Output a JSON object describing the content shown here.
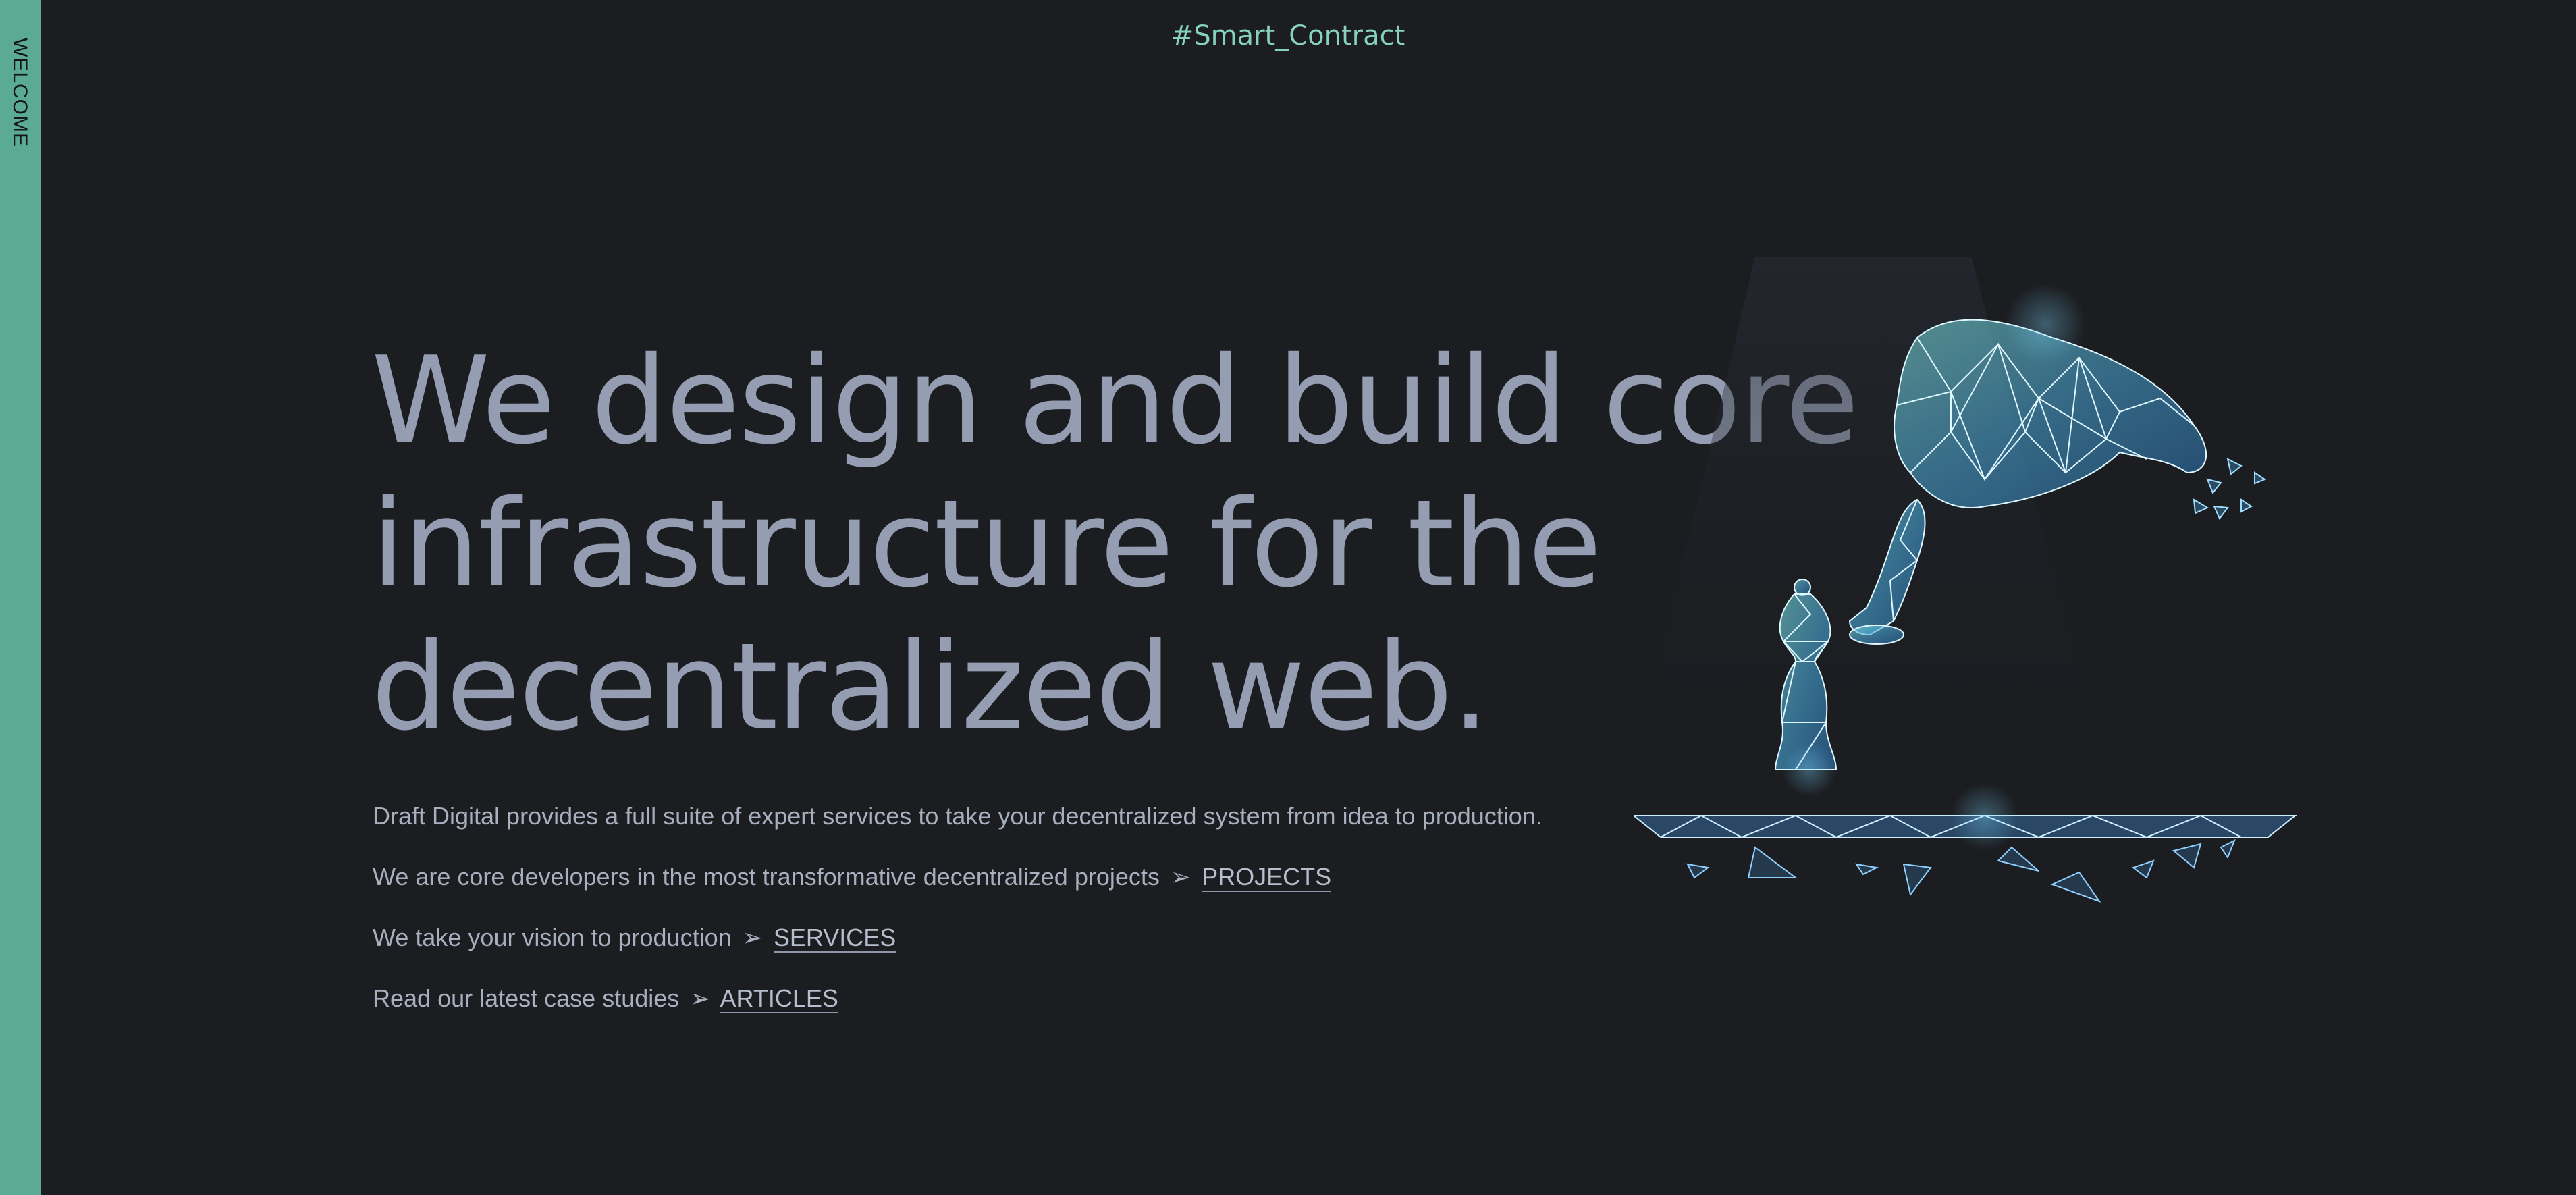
{
  "sidebar": {
    "label": "WELCOME"
  },
  "header": {
    "tag": "#Smart_Contract"
  },
  "hero": {
    "headline_lines": [
      "We design and build core",
      "infrastructure for the",
      "decentralized web."
    ],
    "intro": "Draft Digital provides a full suite of expert services to take your decentralized system from idea to production.",
    "lines": [
      {
        "text": "We are core developers in the most transformative decentralized projects",
        "arrow": "➢",
        "link": "PROJECTS"
      },
      {
        "text": "We take your vision to production",
        "arrow": "➢",
        "link": "SERVICES"
      },
      {
        "text": "Read our latest case studies",
        "arrow": "➢",
        "link": "ARTICLES"
      }
    ]
  },
  "colors": {
    "background": "#1b1d21",
    "accent_rail": "#5aaa94",
    "tag": "#86d3b9",
    "headline": "#959db2",
    "body_text": "#a8afbf"
  },
  "icons": {
    "illustration": "low-poly-chess-hand-illustration"
  }
}
